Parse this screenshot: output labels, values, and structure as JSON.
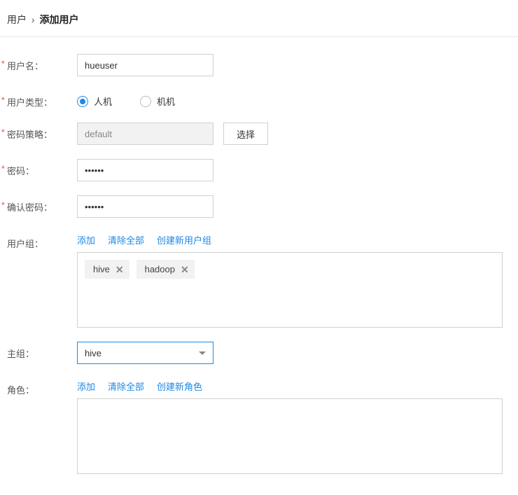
{
  "breadcrumb": {
    "root": "用户",
    "sep": "›",
    "current": "添加用户"
  },
  "labels": {
    "username": "用户名：",
    "usertype": "用户类型：",
    "pwdpolicy": "密码策略：",
    "password": "密码：",
    "confirm": "确认密码：",
    "usergroup": "用户组：",
    "maingroup": "主组：",
    "role": "角色："
  },
  "values": {
    "username": "hueuser",
    "pwdpolicy": "default",
    "password": "••••••",
    "confirm": "••••••",
    "maingroup": "hive"
  },
  "radio": {
    "human": "人机",
    "machine": "机机"
  },
  "buttons": {
    "select": "选择"
  },
  "links": {
    "add": "添加",
    "clear": "清除全部",
    "newGroup": "创建新用户组",
    "newRole": "创建新角色"
  },
  "tags": {
    "g0": "hive",
    "g1": "hadoop"
  }
}
